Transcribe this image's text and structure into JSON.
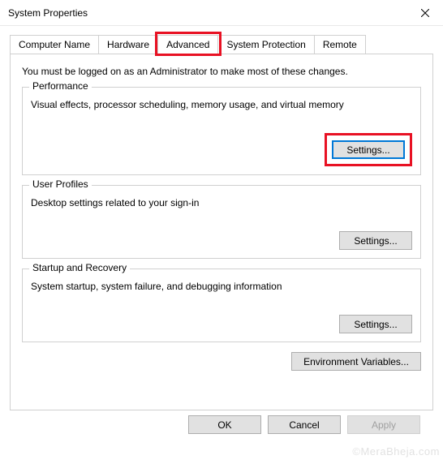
{
  "window": {
    "title": "System Properties"
  },
  "tabs": [
    {
      "label": "Computer Name"
    },
    {
      "label": "Hardware"
    },
    {
      "label": "Advanced"
    },
    {
      "label": "System Protection"
    },
    {
      "label": "Remote"
    }
  ],
  "panel": {
    "admin_note": "You must be logged on as an Administrator to make most of these changes.",
    "performance": {
      "legend": "Performance",
      "desc": "Visual effects, processor scheduling, memory usage, and virtual memory",
      "settings_btn": "Settings..."
    },
    "user_profiles": {
      "legend": "User Profiles",
      "desc": "Desktop settings related to your sign-in",
      "settings_btn": "Settings..."
    },
    "startup": {
      "legend": "Startup and Recovery",
      "desc": "System startup, system failure, and debugging information",
      "settings_btn": "Settings..."
    },
    "env_btn": "Environment Variables..."
  },
  "dialog_buttons": {
    "ok": "OK",
    "cancel": "Cancel",
    "apply": "Apply"
  },
  "highlight": {
    "color": "#e81123"
  },
  "watermark": "©MeraBheja.com"
}
